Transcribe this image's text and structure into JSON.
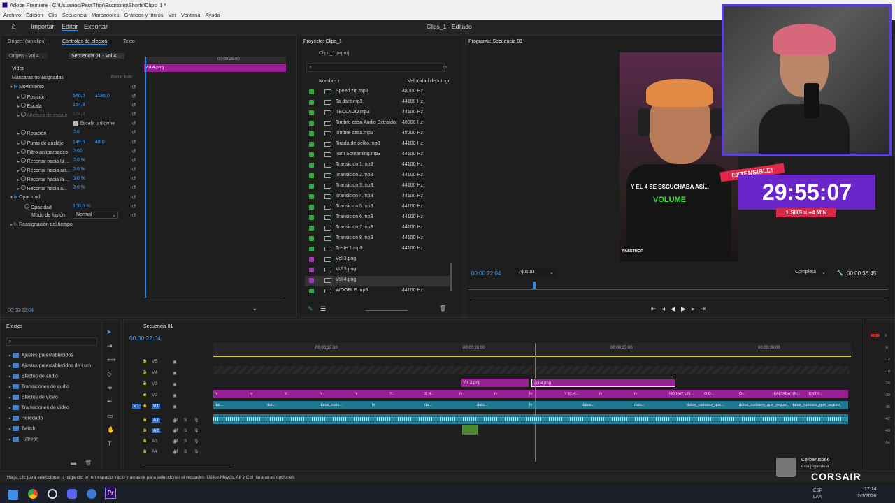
{
  "window": {
    "title": "Adobe Premiere - C:\\Usuarios\\PassThor\\Escritorio\\Shorts\\Clips_1 *"
  },
  "menu": [
    "Archivo",
    "Edición",
    "Clip",
    "Secuencia",
    "Marcadores",
    "Gráficos y títulos",
    "Ver",
    "Ventana",
    "Ayuda"
  ],
  "header": {
    "tabs": [
      "Importar",
      "Editar",
      "Exportar"
    ],
    "project_title": "Clips_1 - Editado"
  },
  "effect_controls": {
    "tabs": [
      "Origen: (sin clips)",
      "Controles de efectos",
      "Texto"
    ],
    "source_a": "Origen - Vol 4....",
    "source_b": "Secuencia 01 - Vol 4....",
    "ruler_time": "00:00:25:00",
    "clip_label": "Vol 4.png",
    "video_label": "Vídeo",
    "masks_label": "Máscaras no asignadas",
    "delete_all": "Borrar todo",
    "motion": "Movimiento",
    "props": [
      {
        "name": "Posición",
        "v1": "540,0",
        "v2": "1186,0"
      },
      {
        "name": "Escala",
        "v1": "154,8",
        "v2": ""
      },
      {
        "name": "Anchura de escala",
        "v1": "174,8",
        "v2": ""
      },
      {
        "name": "Escala uniforme",
        "v1": "",
        "v2": ""
      },
      {
        "name": "Rotación",
        "v1": "0,0",
        "v2": ""
      },
      {
        "name": "Punto de anclaje",
        "v1": "149,5",
        "v2": "48,0"
      },
      {
        "name": "Filtro antiparpadeo",
        "v1": "0,00",
        "v2": ""
      },
      {
        "name": "Recortar hacia la ...",
        "v1": "0,0 %",
        "v2": ""
      },
      {
        "name": "Recortar hacia arr...",
        "v1": "0,0 %",
        "v2": ""
      },
      {
        "name": "Recortar hacia la ...",
        "v1": "0,0 %",
        "v2": ""
      },
      {
        "name": "Recortar hacia a...",
        "v1": "0,0 %",
        "v2": ""
      }
    ],
    "opacity": "Opacidad",
    "opacity_prop": "Opacidad",
    "opacity_val": "100,0 %",
    "blend_label": "Modo de fusión",
    "blend_val": "Normal",
    "time_remap": "Reasignación del tiempo",
    "timecode": "00:00:22:04"
  },
  "project": {
    "tab": "Proyecto: Clips_1",
    "file": "Clips_1.prproj",
    "col_name": "Nombre",
    "col_rate": "Velocidad de fotogr",
    "items": [
      {
        "name": "Speed zip.mp3",
        "rate": "48000 Hz",
        "c": "#3aa84a"
      },
      {
        "name": "Ta dant.mp3",
        "rate": "44100 Hz",
        "c": "#3aa84a"
      },
      {
        "name": "TECLADO.mp3",
        "rate": "44100 Hz",
        "c": "#3aa84a"
      },
      {
        "name": "Timbre casa Audio Extraído.",
        "rate": "48000 Hz",
        "c": "#3aa84a"
      },
      {
        "name": "Timbre casa.mp3",
        "rate": "48000 Hz",
        "c": "#3aa84a"
      },
      {
        "name": "Tirada de pelito.mp3",
        "rate": "44100 Hz",
        "c": "#3aa84a"
      },
      {
        "name": "Tom Screaming.mp3",
        "rate": "44100 Hz",
        "c": "#3aa84a"
      },
      {
        "name": "Transicion 1.mp3",
        "rate": "44100 Hz",
        "c": "#3aa84a"
      },
      {
        "name": "Transicion 2.mp3",
        "rate": "44100 Hz",
        "c": "#3aa84a"
      },
      {
        "name": "Transicion 3.mp3",
        "rate": "44100 Hz",
        "c": "#3aa84a"
      },
      {
        "name": "Transicion 4.mp3",
        "rate": "44100 Hz",
        "c": "#3aa84a"
      },
      {
        "name": "Transicion 5.mp3",
        "rate": "44100 Hz",
        "c": "#3aa84a"
      },
      {
        "name": "Transicion 6.mp3",
        "rate": "44100 Hz",
        "c": "#3aa84a"
      },
      {
        "name": "Transicion 7.mp3",
        "rate": "44100 Hz",
        "c": "#3aa84a"
      },
      {
        "name": "Transicion 8.mp3",
        "rate": "44100 Hz",
        "c": "#3aa84a"
      },
      {
        "name": "Triste 1.mp3",
        "rate": "44100 Hz",
        "c": "#3aa84a"
      },
      {
        "name": "Vol 3.png",
        "rate": "",
        "c": "#a040b0"
      },
      {
        "name": "Vol 3.png",
        "rate": "",
        "c": "#a040b0"
      },
      {
        "name": "Vol 4.png",
        "rate": "",
        "c": "#a040b0"
      },
      {
        "name": "WOOBLE.mp3",
        "rate": "44100 Hz",
        "c": "#3aa84a"
      }
    ]
  },
  "program": {
    "tab": "Programa: Secuencia 01",
    "timecode": "00:00:22:04",
    "fit": "Ajustar",
    "quality": "Completa",
    "duration": "00:00:36:45",
    "video_caption": "Y EL 4 SE ESCUCHABA ASÍ...",
    "video_word": "VOLUME",
    "handle": "PASSTHOR"
  },
  "overlay": {
    "tag": "EXTENSIBLE!",
    "timer": "29:55:07",
    "rule": "1 SUB = +4 MIN"
  },
  "effects": {
    "tab": "Efectos",
    "items": [
      "Ajustes preestablecidos",
      "Ajustes preestablecidos de Lum",
      "Efectos de audio",
      "Transiciones de audio",
      "Efectos de vídeo",
      "Transiciones de vídeo",
      "Heredado",
      "Twitch",
      "Patreon"
    ]
  },
  "timeline": {
    "tab": "Secuencia 01",
    "timecode": "00:00:22:04",
    "ruler": [
      "00:00:15:00",
      "00:00:20:00",
      "00:00:25:00",
      "00:00:30:00"
    ],
    "tracks": [
      "V5",
      "V4",
      "V3",
      "V2",
      "V1",
      "A1",
      "A2",
      "A3",
      "A4"
    ],
    "clip_v2a": "Vol 3.png",
    "clip_v2b": "Vol 4.png",
    "v1_labels": [
      "fx",
      "fx",
      "Y...",
      "fx",
      "fx",
      "Y...",
      "3, 4...",
      "fx",
      "fx",
      "fx",
      "Y EL 4...",
      "fx",
      "fx",
      "NO HAY UN...",
      "O D...",
      "O...",
      "FALTABA UN...",
      "ENTR..."
    ],
    "a_labels": [
      "dat...",
      "dat...",
      "datos_curio...",
      "fx",
      "da...",
      "dato...",
      "fx",
      "datos...",
      "dato...",
      "datos_curiosos_que...",
      "datos_curiosos_que_seguro__si__sabia__v...",
      "datos_curiosos_que_seguro__si__sabia__volv..."
    ],
    "meter": [
      "0",
      "-6",
      "-12",
      "-18",
      "-24",
      "-30",
      "-36",
      "-42",
      "-48",
      "-54"
    ]
  },
  "status": "Haga clic para seleccionar o haga clic en un espacio vacío y arrastre para seleccionar el recuadro. Utilice Mayús, Alt y Ctrl para otras opciones.",
  "notification": {
    "user": "Cerberus666",
    "text": "está jugando a",
    "brand": "CORSAIR"
  },
  "taskbar": {
    "lang1": "ESP",
    "lang2": "LAA",
    "time": "17:14",
    "date": "2/3/2026"
  }
}
